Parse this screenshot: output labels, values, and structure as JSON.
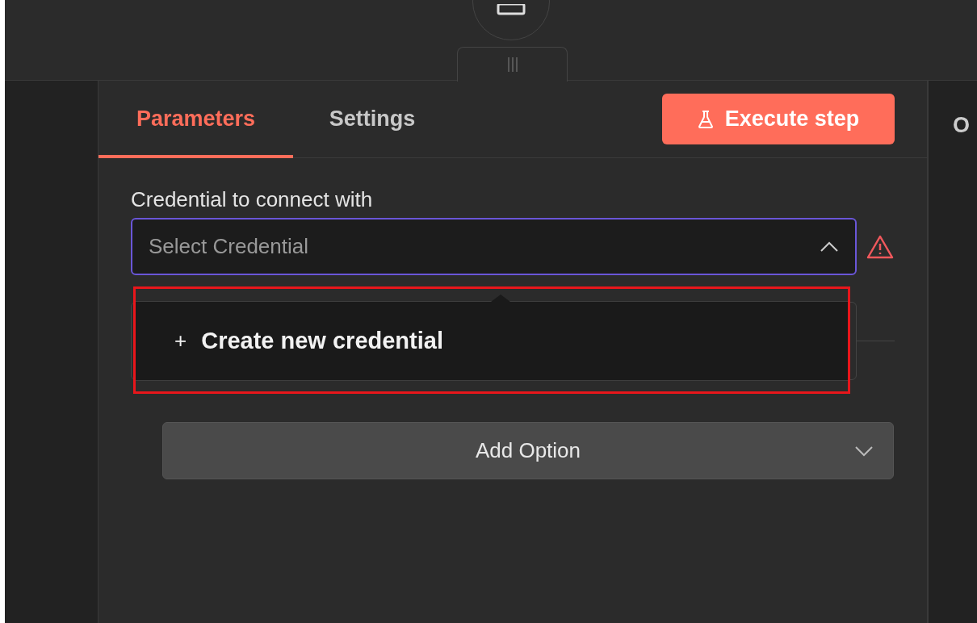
{
  "tabs": [
    {
      "label": "Parameters",
      "selected": true
    },
    {
      "label": "Settings",
      "selected": false
    }
  ],
  "execute_button": {
    "label": "Execute step"
  },
  "credential": {
    "label": "Credential to connect with",
    "placeholder": "Select Credential",
    "expanded": true,
    "warning": true
  },
  "dropdown": {
    "items": [
      {
        "icon": "+",
        "label": "Create new credential"
      }
    ]
  },
  "options": {
    "add_button": "Add Option"
  },
  "right_panel": {
    "heading": "O"
  }
}
